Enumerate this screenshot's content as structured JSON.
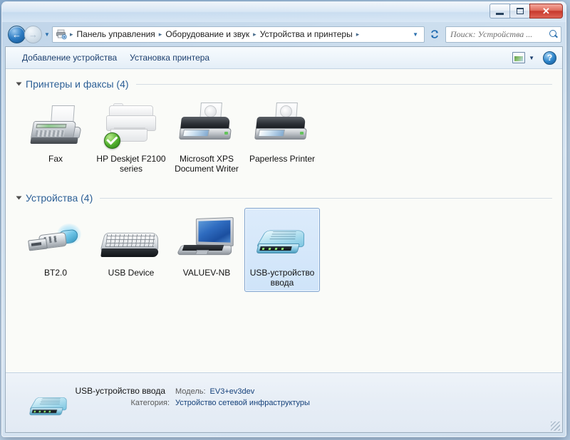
{
  "window": {
    "controls": {
      "minimize": "–",
      "maximize": "□",
      "close": "✕"
    }
  },
  "navigation": {
    "back_label": "←",
    "forward_label": "→",
    "history_caret": "▼",
    "breadcrumb_icon": "devices-printers-icon",
    "crumbs": [
      "Панель управления",
      "Оборудование и звук",
      "Устройства и принтеры"
    ],
    "separator": "▸",
    "dropdown_caret": "▼",
    "refresh_label": "↻"
  },
  "search": {
    "placeholder": "Поиск: Устройства ...",
    "value": ""
  },
  "toolbar": {
    "add_device": "Добавление устройства",
    "add_printer": "Установка принтера",
    "view_caret": "▼",
    "help_label": "?"
  },
  "groups": [
    {
      "id": "printers",
      "title": "Принтеры и факсы (4)",
      "items": [
        {
          "label": "Fax",
          "icon": "fax-icon",
          "selected": false,
          "default_badge": false
        },
        {
          "label": "HP Deskjet F2100 series",
          "icon": "hp-deskjet-printer-icon",
          "selected": false,
          "default_badge": true
        },
        {
          "label": "Microsoft XPS Document Writer",
          "icon": "printer-icon",
          "selected": false,
          "default_badge": false
        },
        {
          "label": "Paperless Printer",
          "icon": "printer-icon",
          "selected": false,
          "default_badge": false
        }
      ]
    },
    {
      "id": "devices",
      "title": "Устройства (4)",
      "items": [
        {
          "label": "BT2.0",
          "icon": "bluetooth-dongle-icon",
          "selected": false,
          "default_badge": false
        },
        {
          "label": "USB Device",
          "icon": "keyboard-icon",
          "selected": false,
          "default_badge": false
        },
        {
          "label": "VALUEV-NB",
          "icon": "laptop-icon",
          "selected": false,
          "default_badge": false
        },
        {
          "label": "USB-устройство ввода",
          "icon": "network-device-icon",
          "selected": true,
          "default_badge": false
        }
      ]
    }
  ],
  "details": {
    "icon": "network-device-icon",
    "name": "USB-устройство ввода",
    "model_key": "Модель:",
    "model_value": "EV3+ev3dev",
    "category_key": "Категория:",
    "category_value": "Устройство сетевой инфраструктуры"
  },
  "colors": {
    "accent": "#2c5f96",
    "selection_border": "#7da2ce",
    "link_text": "#1c3f6e",
    "detail_value": "#14407a",
    "close_button": "#c7392c",
    "default_badge": "#4fae2b"
  }
}
